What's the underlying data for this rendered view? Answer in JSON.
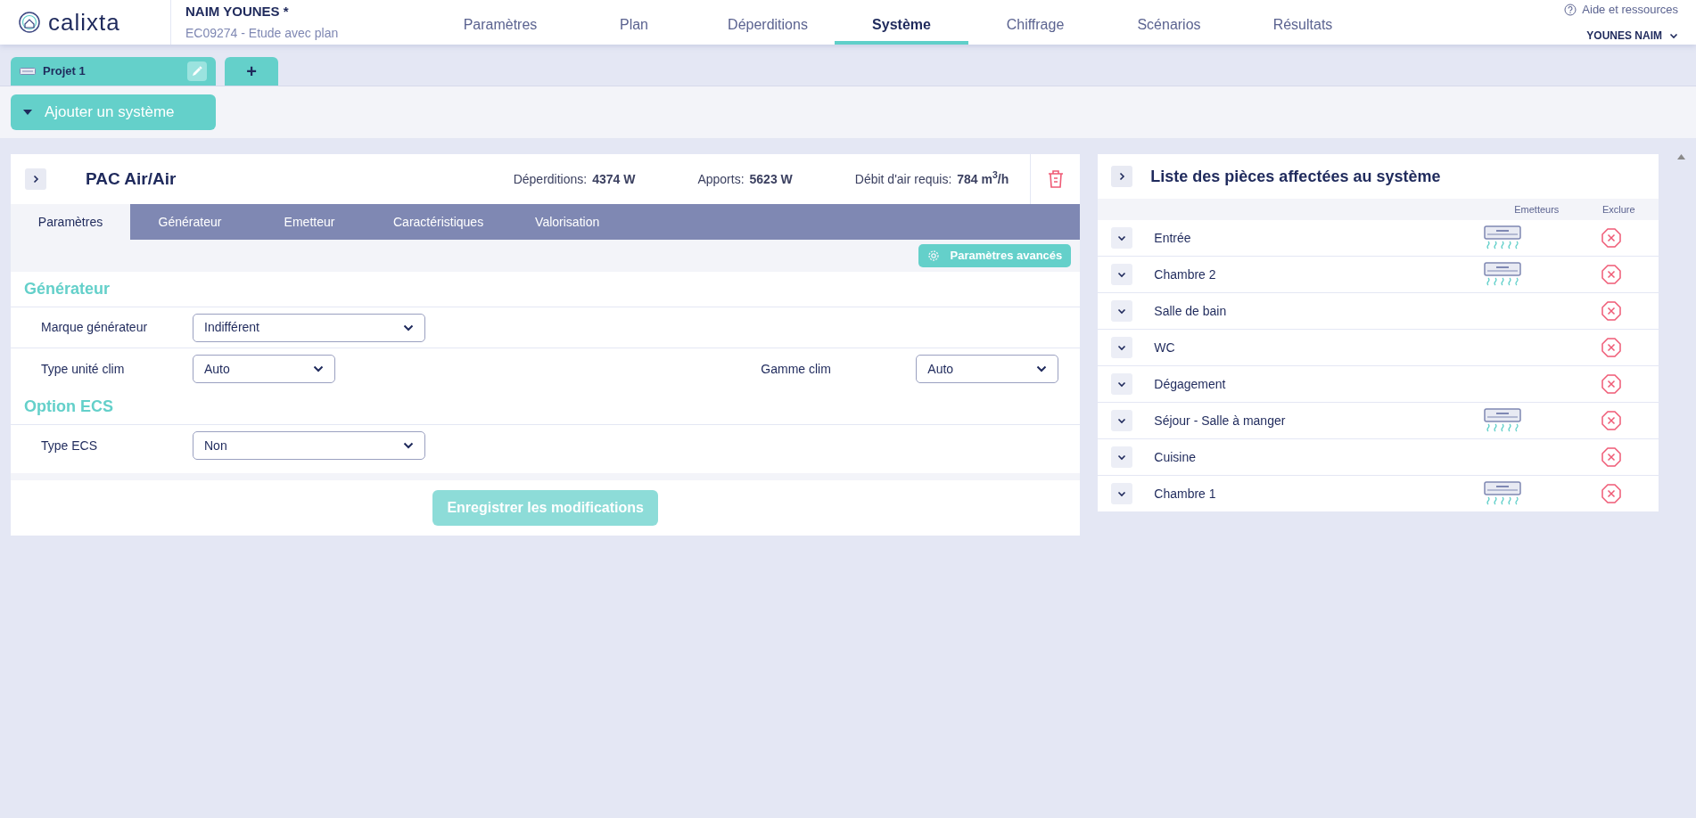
{
  "header": {
    "logo": "calixta",
    "client": "NAIM YOUNES *",
    "study": "EC09274 - Etude avec plan",
    "help": "Aide et ressources",
    "user": "YOUNES NAIM",
    "nav": [
      {
        "label": "Paramètres",
        "selected": false
      },
      {
        "label": "Plan",
        "selected": false
      },
      {
        "label": "Déperditions",
        "selected": false
      },
      {
        "label": "Système",
        "selected": true
      },
      {
        "label": "Chiffrage",
        "selected": false
      },
      {
        "label": "Scénarios",
        "selected": false
      },
      {
        "label": "Résultats",
        "selected": false
      }
    ]
  },
  "project_tabs": [
    {
      "label": "Projet 1",
      "kind": "project"
    },
    {
      "label": "+",
      "kind": "add"
    }
  ],
  "add_system": {
    "label": "Ajouter un système",
    "expanded": false
  },
  "system": {
    "name": "PAC Air/Air",
    "stats": [
      {
        "label": "Déperditions:",
        "value": "4374 W"
      },
      {
        "label": "Apports:",
        "value": "5623 W"
      },
      {
        "label": "Débit d'air requis:",
        "value": "784 m$^{3}$/h"
      }
    ],
    "tabs": [
      {
        "label": "Paramètres",
        "selected": true
      },
      {
        "label": "Générateur",
        "selected": false
      },
      {
        "label": "Emetteur",
        "selected": false
      },
      {
        "label": "Caractéristiques",
        "selected": false
      },
      {
        "label": "Valorisation",
        "selected": false
      }
    ],
    "advanced_button": "Paramètres avancés",
    "sections": [
      {
        "title": "Générateur",
        "rows": [
          {
            "fields": [
              {
                "label": "Marque générateur",
                "value": "Indifférent"
              }
            ]
          },
          {
            "fields": [
              {
                "label": "Type unité clim",
                "value": "Auto"
              },
              {
                "label": "Gamme clim",
                "value": "Auto"
              }
            ]
          }
        ]
      },
      {
        "title": "Option ECS",
        "rows": [
          {
            "fields": [
              {
                "label": "Type ECS",
                "value": "Non"
              }
            ]
          }
        ]
      }
    ],
    "save_button": {
      "label": "Enregistrer les modifications",
      "disabled": true
    }
  },
  "rooms": {
    "title": "Liste des pièces affectées au système",
    "columns": [
      "Emetteurs",
      "Exclure"
    ],
    "items": [
      {
        "name": "Entrée",
        "has_emitter": true
      },
      {
        "name": "Chambre 2",
        "has_emitter": true
      },
      {
        "name": "Salle de bain",
        "has_emitter": false
      },
      {
        "name": "WC",
        "has_emitter": false
      },
      {
        "name": "Dégagement",
        "has_emitter": false
      },
      {
        "name": "Séjour - Salle à manger",
        "has_emitter": true
      },
      {
        "name": "Cuisine",
        "has_emitter": false
      },
      {
        "name": "Chambre 1",
        "has_emitter": true
      }
    ]
  }
}
